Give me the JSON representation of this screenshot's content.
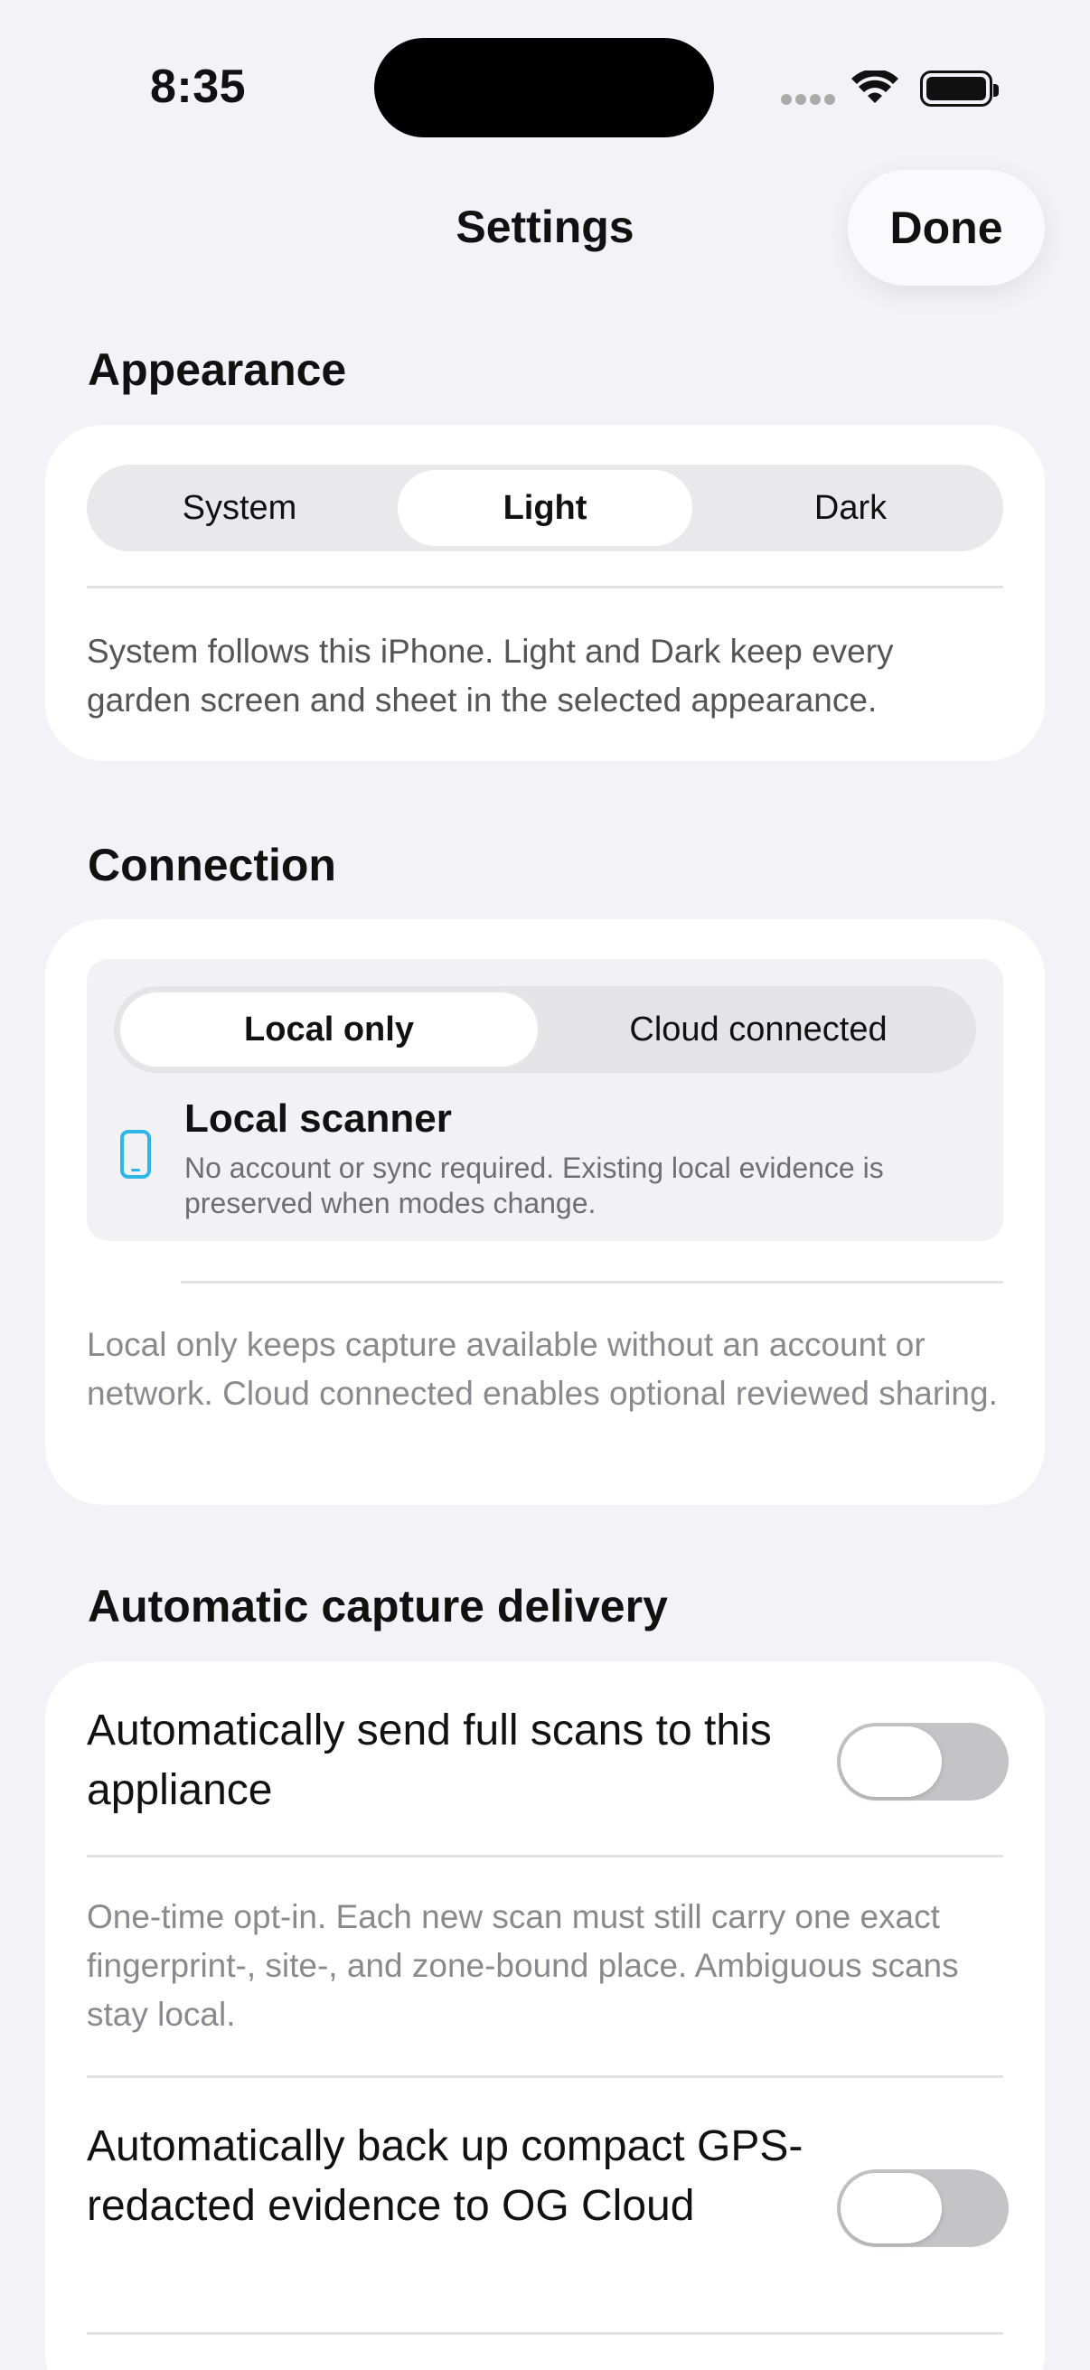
{
  "status_bar": {
    "time": "8:35"
  },
  "nav": {
    "title": "Settings",
    "done_label": "Done"
  },
  "appearance": {
    "header": "Appearance",
    "options": [
      "System",
      "Light",
      "Dark"
    ],
    "selected": "Light",
    "note": "System follows this iPhone. Light and Dark keep every garden screen and sheet in the selected appearance."
  },
  "connection": {
    "header": "Connection",
    "options": [
      "Local only",
      "Cloud connected"
    ],
    "selected": "Local only",
    "scanner_title": "Local scanner",
    "scanner_desc": "No account or sync required. Existing local evidence is preserved when modes change.",
    "note": "Local only keeps capture available without an account or network. Cloud connected enables optional reviewed sharing."
  },
  "capture": {
    "header": "Automatic capture delivery",
    "send_full_label": "Automatically send full scans to this appliance",
    "send_full_on": false,
    "send_full_note": "One-time opt-in. Each new scan must still carry one exact fingerprint-, site-, and zone-bound place. Ambiguous scans stay local.",
    "backup_label": "Automatically back up compact GPS-redacted evidence to OG Cloud",
    "backup_on": false
  },
  "colors": {
    "accent": "#2fb6e8",
    "toggle_off": "#c4c4c6",
    "background": "#f2f2f7"
  }
}
